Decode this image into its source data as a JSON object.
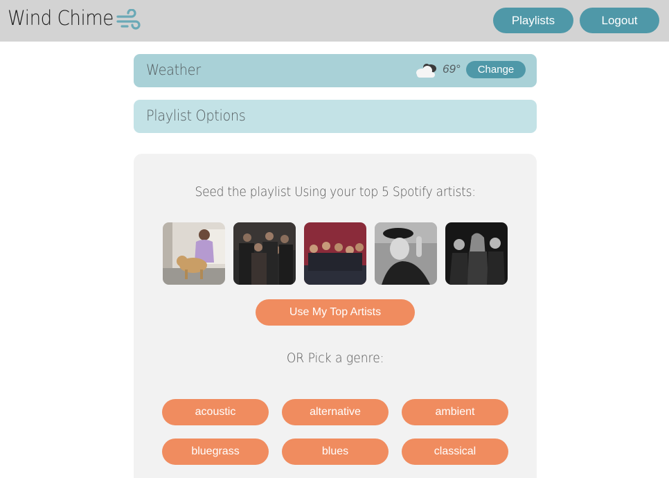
{
  "header": {
    "title": "Wind Chime",
    "logo_icon": "wind-icon",
    "nav": {
      "playlists_label": "Playlists",
      "logout_label": "Logout"
    }
  },
  "weather_panel": {
    "title": "Weather",
    "icon": "cloud-icon",
    "temperature": "69°",
    "change_label": "Change"
  },
  "options_panel": {
    "title": "Playlist Options"
  },
  "seed": {
    "prompt": "Seed the playlist Using your top 5 Spotify artists:",
    "artists_count": 5,
    "use_top_label": "Use My Top Artists",
    "or_text": "OR Pick a genre:"
  },
  "genres": [
    "acoustic",
    "alternative",
    "ambient",
    "bluegrass",
    "blues",
    "classical"
  ],
  "colors": {
    "topbar": "#d3d3d3",
    "accent_teal": "#4f98a8",
    "weather_panel": "#a9d1d7",
    "options_panel": "#c3e2e6",
    "card": "#f2f2f2",
    "accent_orange": "#f08c5f"
  }
}
